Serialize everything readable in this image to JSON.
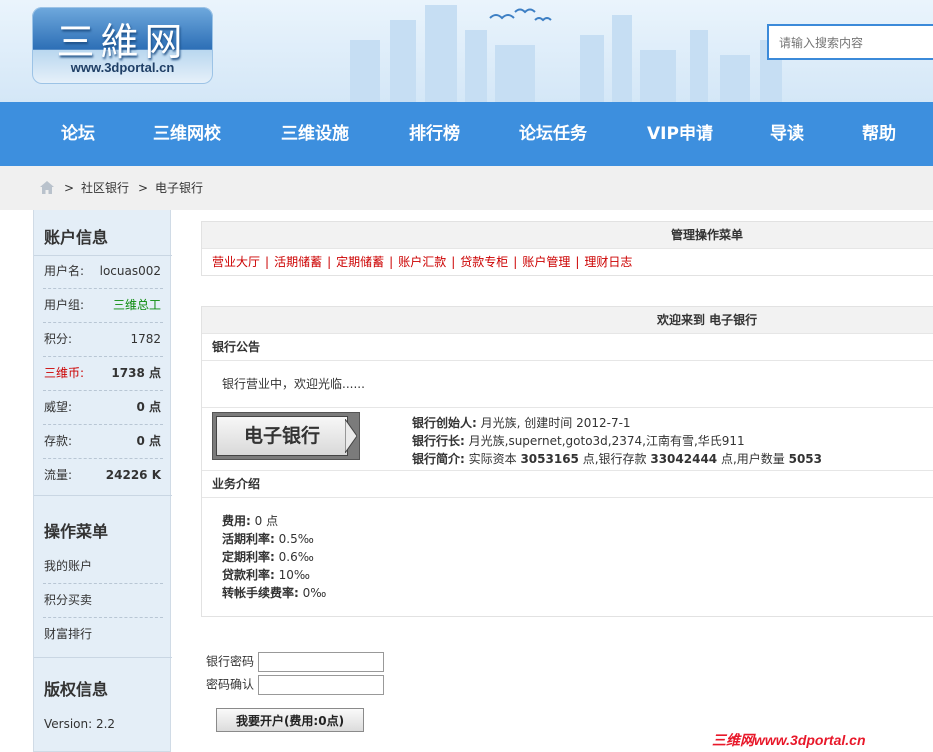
{
  "header": {
    "logo_main": "三維网",
    "logo_sub": "www.3dportal.cn",
    "search_placeholder": "请输入搜索内容"
  },
  "nav": [
    "论坛",
    "三维网校",
    "三维设施",
    "排行榜",
    "论坛任务",
    "VIP申请",
    "导读",
    "帮助"
  ],
  "breadcrumb": {
    "sep": ">",
    "items": [
      "社区银行",
      "电子银行"
    ]
  },
  "sidebar": {
    "account_title": "账户信息",
    "rows": [
      {
        "k": "用户名:",
        "v": "locuas002"
      },
      {
        "k": "用户组:",
        "v": "三维总工"
      },
      {
        "k": "积分:",
        "v": "1782"
      },
      {
        "k": "三维币:",
        "v": "1738 点"
      },
      {
        "k": "威望:",
        "v": "0 点"
      },
      {
        "k": "存款:",
        "v": "0 点"
      },
      {
        "k": "流量:",
        "v": "24226 K"
      }
    ],
    "menu_title": "操作菜单",
    "menu": [
      "我的账户",
      "积分买卖",
      "财富排行"
    ],
    "copyright_title": "版权信息",
    "version": "Version: 2.2",
    "colors": {
      "group": "#0a8a0a",
      "coin_label": "#cc0000"
    }
  },
  "ops": {
    "title": "管理操作菜单",
    "items": [
      "营业大厅",
      "活期储蓄",
      "定期储蓄",
      "账户汇款",
      "贷款专柜",
      "账户管理",
      "理财日志"
    ]
  },
  "welcome": {
    "title": "欢迎来到 电子银行",
    "notice_title": "银行公告",
    "notice": "银行营业中，欢迎光临......",
    "logo_text": "电子银行",
    "founder_label": "银行创始人:",
    "founder": " 月光族, 创建时间 2012-7-1",
    "president_label": "银行行长:",
    "president": " 月光族,supernet,goto3d,2374,江南有雪,华氏911",
    "intro_label": "银行简介:",
    "intro_a": " 实际资本 ",
    "capital": "3053165",
    "intro_b": " 点,银行存款 ",
    "deposit": "33042444",
    "intro_c": " 点,用户数量 ",
    "users": "5053",
    "business_title": "业务介绍",
    "rates": [
      {
        "k": "费用:",
        "v": " 0 点"
      },
      {
        "k": "活期利率:",
        "v": " 0.5‰"
      },
      {
        "k": "定期利率:",
        "v": " 0.6‰"
      },
      {
        "k": "贷款利率:",
        "v": " 10‰"
      },
      {
        "k": "转帐手续费率:",
        "v": " 0‰"
      }
    ]
  },
  "form": {
    "password_label": "银行密码",
    "confirm_label": "密码确认",
    "open_button": "我要开户(费用:0点)"
  },
  "watermark": "三维网www.3dportal.cn",
  "accent_color": "#3d8fde"
}
